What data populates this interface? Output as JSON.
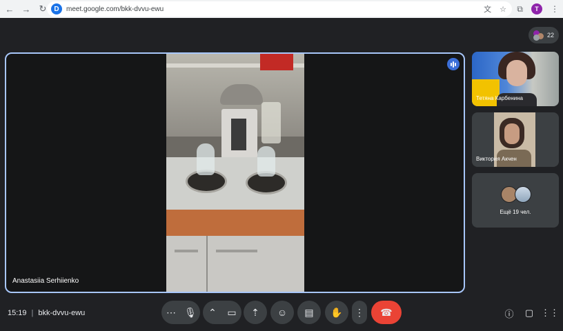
{
  "browser": {
    "url": "meet.google.com/bkk-dvvu-ewu",
    "site_badge": "D",
    "profile_initial": "T"
  },
  "meet": {
    "participants_count": "22",
    "main_tile": {
      "name": "Anastasiia Serhiienko"
    },
    "side_tiles": [
      {
        "name": "Тетяна Карбенина"
      },
      {
        "name": "Виктория Акчен"
      },
      {
        "name": "Ещё 19 чел."
      }
    ]
  },
  "bottom_bar": {
    "time": "15:19",
    "separator": "|",
    "meeting_code": "bkk-dvvu-ewu"
  },
  "colors": {
    "background": "#202124",
    "control_button": "#3c4043",
    "hangup": "#ea4335",
    "active_tile_border": "#a8c7fa",
    "speaking_badge": "#3c6fd8"
  },
  "icons": [
    "back-arrow-icon",
    "forward-arrow-icon",
    "reload-icon",
    "translate-icon",
    "star-icon",
    "extensions-icon",
    "menu-dots-icon",
    "more-options-icon",
    "mic-icon",
    "chevron-up-icon",
    "camera-icon",
    "present-icon",
    "emoji-icon",
    "captions-icon",
    "raise-hand-icon",
    "hangup-icon",
    "info-icon",
    "chat-icon",
    "activities-icon"
  ]
}
